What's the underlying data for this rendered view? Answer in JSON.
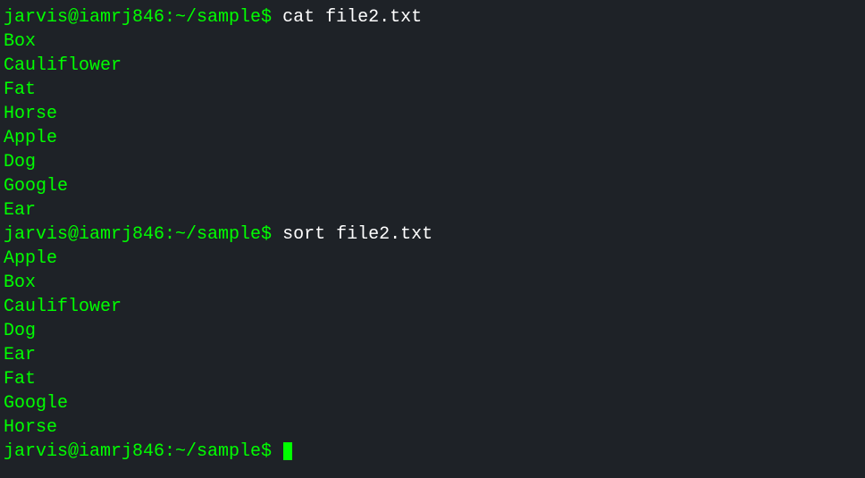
{
  "terminal": {
    "lines": [
      {
        "type": "prompt",
        "prompt": "jarvis@iamrj846:~/sample$ ",
        "command": "cat file2.txt"
      },
      {
        "type": "output",
        "text": "Box"
      },
      {
        "type": "output",
        "text": "Cauliflower"
      },
      {
        "type": "output",
        "text": "Fat"
      },
      {
        "type": "output",
        "text": "Horse"
      },
      {
        "type": "output",
        "text": "Apple"
      },
      {
        "type": "output",
        "text": "Dog"
      },
      {
        "type": "output",
        "text": "Google"
      },
      {
        "type": "output",
        "text": "Ear"
      },
      {
        "type": "prompt",
        "prompt": "jarvis@iamrj846:~/sample$ ",
        "command": "sort file2.txt"
      },
      {
        "type": "output",
        "text": "Apple"
      },
      {
        "type": "output",
        "text": "Box"
      },
      {
        "type": "output",
        "text": "Cauliflower"
      },
      {
        "type": "output",
        "text": "Dog"
      },
      {
        "type": "output",
        "text": "Ear"
      },
      {
        "type": "output",
        "text": "Fat"
      },
      {
        "type": "output",
        "text": "Google"
      },
      {
        "type": "output",
        "text": "Horse"
      },
      {
        "type": "prompt-empty",
        "prompt": "jarvis@iamrj846:~/sample$ ",
        "command": ""
      }
    ]
  }
}
